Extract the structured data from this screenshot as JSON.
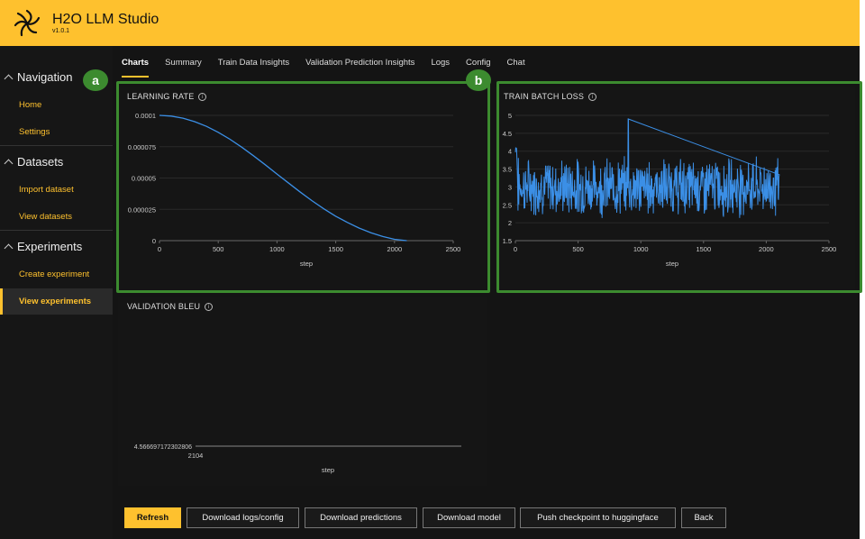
{
  "header": {
    "title": "H2O LLM Studio",
    "version": "v1.0.1"
  },
  "sidebar": {
    "groups": [
      {
        "label": "Navigation",
        "items": [
          "Home",
          "Settings"
        ]
      },
      {
        "label": "Datasets",
        "items": [
          "Import dataset",
          "View datasets"
        ]
      },
      {
        "label": "Experiments",
        "items": [
          "Create experiment",
          "View experiments"
        ]
      }
    ],
    "active_item": "View experiments"
  },
  "tabs": [
    "Charts",
    "Summary",
    "Train Data Insights",
    "Validation Prediction Insights",
    "Logs",
    "Config",
    "Chat"
  ],
  "active_tab": "Charts",
  "markers": {
    "a": "a",
    "b": "b"
  },
  "charts": {
    "learning_rate": {
      "title": "LEARNING RATE"
    },
    "train_batch_loss": {
      "title": "TRAIN BATCH LOSS"
    },
    "validation_bleu": {
      "title": "VALIDATION BLEU"
    }
  },
  "chart_data": [
    {
      "type": "line",
      "title": "LEARNING RATE",
      "xlabel": "step",
      "ylabel": "",
      "xlim": [
        0,
        2500
      ],
      "ylim": [
        0,
        0.0001
      ],
      "x_ticks": [
        "0",
        "500",
        "1000",
        "1500",
        "2000",
        "2500"
      ],
      "y_ticks": [
        "0",
        "0.000025",
        "0.00005",
        "0.000075",
        "0.0001"
      ],
      "series": [
        {
          "x": [
            0,
            100,
            200,
            300,
            400,
            500,
            600,
            700,
            800,
            900,
            1000,
            1100,
            1200,
            1300,
            1400,
            1500,
            1600,
            1700,
            1800,
            1900,
            2000,
            2104
          ],
          "y": [
            0.0001,
            9.94e-05,
            9.78e-05,
            9.5e-05,
            9.12e-05,
            8.65e-05,
            8.09e-05,
            7.46e-05,
            6.78e-05,
            6.06e-05,
            5.32e-05,
            4.59e-05,
            3.86e-05,
            3.17e-05,
            2.53e-05,
            1.95e-05,
            1.45e-05,
            1e-05,
            6.3e-06,
            3.3e-06,
            1.1e-06,
            0
          ]
        }
      ]
    },
    {
      "type": "line",
      "title": "TRAIN BATCH LOSS",
      "xlabel": "step",
      "ylabel": "",
      "xlim": [
        0,
        2500
      ],
      "ylim": [
        1.5,
        5
      ],
      "x_ticks": [
        "0",
        "500",
        "1000",
        "1500",
        "2000",
        "2500"
      ],
      "y_ticks": [
        "1.5",
        "2",
        "2.5",
        "3",
        "3.5",
        "4",
        "4.5",
        "5"
      ],
      "series": [
        {
          "x_range": [
            0,
            2104
          ],
          "mean": 3.0,
          "spread": 0.6,
          "peak": {
            "x": 900,
            "y": 4.9
          }
        }
      ]
    },
    {
      "type": "line",
      "title": "VALIDATION BLEU",
      "xlabel": "step",
      "ylabel": "",
      "x_ticks": [
        "2104"
      ],
      "y_ticks": [
        "4.566697172302806"
      ],
      "series": [
        {
          "x": [
            2104
          ],
          "y": [
            4.566697172302806
          ]
        }
      ]
    }
  ],
  "footer": {
    "buttons": [
      "Refresh",
      "Download logs/config",
      "Download predictions",
      "Download model",
      "Push checkpoint to huggingface",
      "Back"
    ]
  },
  "colors": {
    "accent": "#fec12e",
    "line": "#3b8fe6",
    "highlight": "#3c8b2f"
  }
}
